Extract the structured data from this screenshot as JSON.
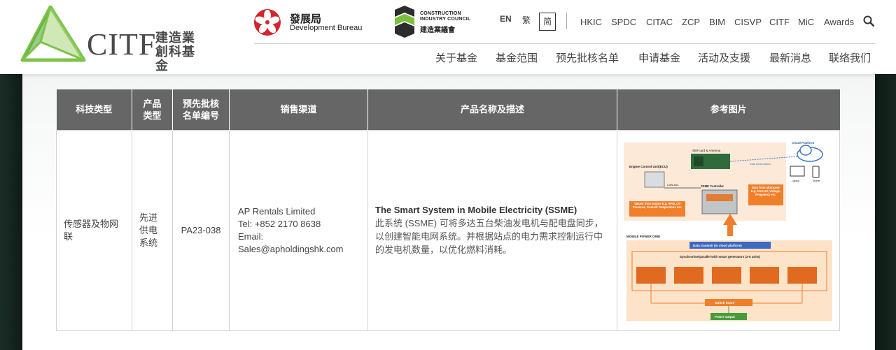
{
  "brand": {
    "logo_text": "CITF",
    "logo_cn": "建造業創科基金",
    "devb_zh": "發展局",
    "devb_en": "Development Bureau",
    "cic_en": "CONSTRUCTION INDUSTRY COUNCIL",
    "cic_zh": "建造業議會"
  },
  "lang": {
    "en": "EN",
    "tc": "繁",
    "sc": "简"
  },
  "toplinks": [
    "HKIC",
    "SPDC",
    "CITAC",
    "ZCP",
    "BIM",
    "CISVP",
    "CITF",
    "MiC",
    "Awards"
  ],
  "nav": [
    "关于基金",
    "基金范围",
    "预先批核名单",
    "申请基金",
    "活动及支援",
    "最新消息",
    "联络我们"
  ],
  "table": {
    "headers": [
      "科技类型",
      "产品类型",
      "预先批核名单编号",
      "销售渠道",
      "产品名称及描述",
      "参考图片"
    ],
    "row": {
      "tech_type": "传感器及物网联",
      "product_type": "先进供电系统",
      "code": "PA23-038",
      "channel": {
        "company": "AP Rentals Limited",
        "tel": "Tel: +852 2170 8638",
        "email_label": "Email:",
        "email": "Sales@apholdingshk.com"
      },
      "product_name": "The Smart System in Mobile Electricity (SSME)",
      "product_desc": "此系统 (SSME) 可将多达五台柴油发电机与配电盘同步，以创建智能电网系统。并根据站点的电力需求控制运行中的发电机数量，以优化燃料消耗。"
    }
  },
  "diagram": {
    "cloud": "Cloud Platform",
    "sim": "SIM-card & Antenna",
    "ecu": "Engine Control Unit(ECU)",
    "canbus": "CAN-bus",
    "ssme": "SSME Controller",
    "data_tx": "Data transmission",
    "laptop": "Laptop",
    "mobile": "Mobile",
    "engine_values": "Values from engine E.g. RPM, Oil Pressure, Coolant Temperature etc.",
    "alt_data": "Data from alternator E.g. Current, Voltage, Frequency etc.",
    "grid": "MOBILE POWER GRID",
    "grid_tx": "Data transmit (to cloud platform)",
    "sync": "Synchronise/parallel with smart generators (2-5 units)",
    "switch": "Switch board",
    "output": "Power output",
    "accent": "#f07f2c",
    "header_gray": "#666666"
  }
}
